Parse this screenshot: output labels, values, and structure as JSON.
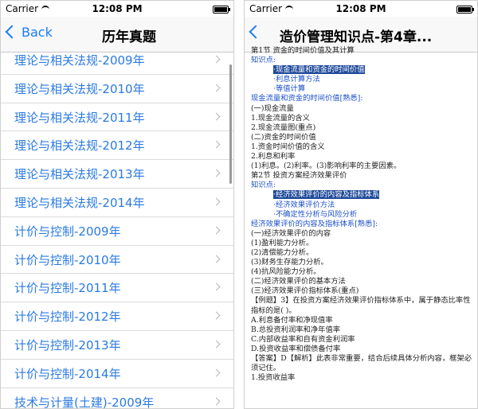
{
  "left": {
    "status": {
      "carrier": "Carrier",
      "time": "12:08 PM"
    },
    "nav": {
      "back_label": "Back",
      "title": "历年真题"
    },
    "items": [
      "理论与相关法规-2009年",
      "理论与相关法规-2010年",
      "理论与相关法规-2011年",
      "理论与相关法规-2012年",
      "理论与相关法规-2013年",
      "理论与相关法规-2014年",
      "计价与控制-2009年",
      "计价与控制-2010年",
      "计价与控制-2011年",
      "计价与控制-2012年",
      "计价与控制-2013年",
      "计价与控制-2014年",
      "技术与计量(土建)-2009年"
    ]
  },
  "right": {
    "status": {
      "carrier": "Carrier",
      "time": "12:08 PM"
    },
    "nav": {
      "title": "造价管理知识点-第4章..."
    },
    "content": {
      "l1": "第1节 资金的时间价值及其计算",
      "l2": "知识点:",
      "l3": "·现金流量和资金的时间价值",
      "l4": "·利息计算方法",
      "l5": "·等值计算",
      "l6": "现金流量和资金的时间价值[熟悉]:",
      "l7": "(一)现金流量",
      "l8": "1.现金流量的含义",
      "l9": "2.现金流量图(重点)",
      "l10": "(二)资金的时间价值",
      "l11": "1.资金时间价值的含义",
      "l12": "2.利息和利率",
      "l13": "(1)利息。(2)利率。(3)影响利率的主要因素。",
      "l14": "第2节 投资方案经济效果评价",
      "l15": "知识点:",
      "l16": "·经济效果评价的内容及指标体系",
      "l17": "·经济效果评价方法",
      "l18": "·不确定性分析与风险分析",
      "l19": "经济效果评价的内容及指标体系[熟悉]:",
      "l20": "(一)经济效果评价的内容",
      "l21": "(1)盈利能力分析。",
      "l22": "(2)清偿能力分析。",
      "l23": "(3)财务生存能力分析。",
      "l24": "(4)抗风险能力分析。",
      "l25": "(二)经济效果评价的基本方法",
      "l26": "(三)经济效果评价指标体系(重点)",
      "l27": "【例题】3】在投资方案经济效果评价指标体系中，属于静态比率性指标的是(   )。",
      "l28": "A.利息备付率和净现值率",
      "l29": "B.总投资利润率和净年值率",
      "l30": "C.内部收益率和自有资金利润率",
      "l31": "D.投资收益率和偿债备付率",
      "l32": "【答案】D【解析】此表非常重要，结合后续具体分析内容，框架必须记住。",
      "l33": "1.投资收益率"
    }
  }
}
